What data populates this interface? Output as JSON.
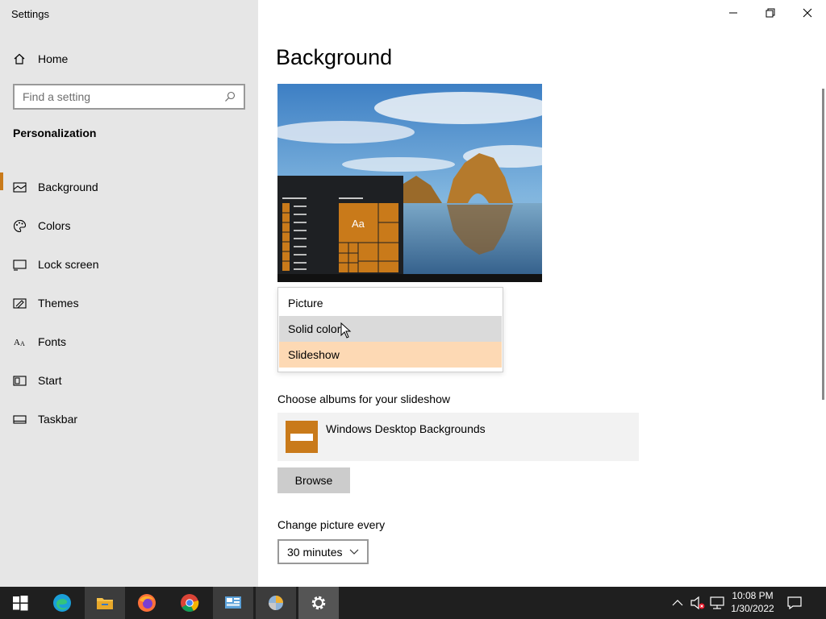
{
  "window": {
    "title": "Settings"
  },
  "sidebar": {
    "home_label": "Home",
    "search_placeholder": "Find a setting",
    "section_title": "Personalization",
    "items": [
      {
        "label": "Background",
        "icon": "picture-icon",
        "active": true
      },
      {
        "label": "Colors",
        "icon": "palette-icon"
      },
      {
        "label": "Lock screen",
        "icon": "lock-screen-icon"
      },
      {
        "label": "Themes",
        "icon": "themes-icon"
      },
      {
        "label": "Fonts",
        "icon": "fonts-icon"
      },
      {
        "label": "Start",
        "icon": "start-icon"
      },
      {
        "label": "Taskbar",
        "icon": "taskbar-icon"
      }
    ]
  },
  "main": {
    "title": "Background",
    "preview": {
      "sample_text": "Aa"
    },
    "background_dropdown": {
      "options": [
        "Picture",
        "Solid color",
        "Slideshow"
      ],
      "hovered": "Solid color",
      "selected": "Slideshow"
    },
    "albums_label": "Choose albums for your slideshow",
    "album_name": "Windows Desktop Backgrounds",
    "browse_label": "Browse",
    "change_label": "Change picture every",
    "change_value": "30 minutes"
  },
  "taskbar": {
    "apps": [
      "start-icon",
      "edge-icon",
      "file-explorer-icon",
      "firefox-icon",
      "chrome-icon",
      "control-panel-icon",
      "unknown-app-icon",
      "settings-icon"
    ],
    "time": "10:08 PM",
    "date": "1/30/2022"
  },
  "colors": {
    "accent": "#c97a1a",
    "sidebar_bg": "#e6e6e6",
    "selected_option": "#fdd9b4",
    "taskbar_bg": "#1f1f1f"
  }
}
